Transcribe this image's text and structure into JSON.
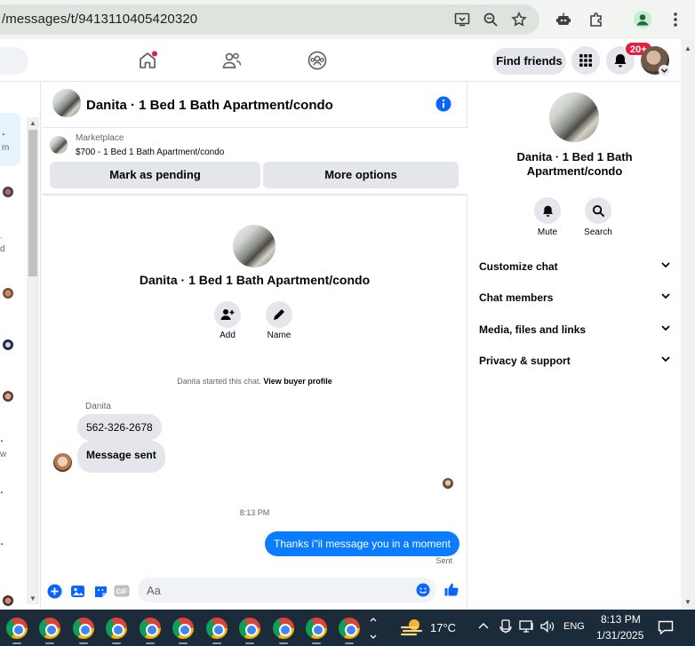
{
  "browser": {
    "url": "/messages/t/9413110405420320"
  },
  "header": {
    "find_friends_label": "Find friends",
    "notification_count": "20+"
  },
  "conversation": {
    "title": "Danita · 1 Bed 1 Bath Apartment/condo",
    "marketplace_label": "Marketplace",
    "listing": "$700 - 1 Bed 1 Bath Apartment/condo",
    "mark_pending_label": "Mark as pending",
    "more_options_label": "More options",
    "intro_title": "Danita · 1 Bed 1 Bath Apartment/condo",
    "add_label": "Add",
    "name_label": "Name",
    "system_message": "Danita started this chat.",
    "view_buyer_profile": "View buyer profile",
    "sender_name": "Danita",
    "messages_in": [
      "562-326-2678",
      "Message sent"
    ],
    "timestamp": "8:13 PM",
    "message_out": "Thanks i\"il message you in a moment",
    "sent_status": "Sent",
    "composer_placeholder": "Aa"
  },
  "right_panel": {
    "title": "Danita · 1 Bed 1 Bath Apartment/condo",
    "mute_label": "Mute",
    "search_label": "Search",
    "sections": [
      "Customize chat",
      "Chat members",
      "Media, files and links",
      "Privacy & support"
    ]
  },
  "left_list": {
    "fragments": [
      ".",
      "m",
      "d",
      "w"
    ]
  },
  "taskbar": {
    "temperature": "17°C",
    "language": "ENG",
    "time": "8:13 PM",
    "date": "1/31/2025"
  },
  "colors": {
    "messenger_blue": "#0a7cff",
    "badge_red": "#e41e3f",
    "info_blue": "#0866ff",
    "taskbar_bg": "#1c2b3a"
  },
  "icons": [
    "screen-cast-icon",
    "zoom-icon",
    "star-icon",
    "extension-robot-icon",
    "puzzle-icon",
    "profile-icon",
    "kebab-menu-icon",
    "home-icon",
    "friends-icon",
    "groups-icon",
    "menu-grid-icon",
    "bell-icon",
    "info-icon",
    "add-person-icon",
    "pencil-icon",
    "plus-circle-icon",
    "image-icon",
    "sticker-icon",
    "gif-icon",
    "emoji-icon",
    "thumbs-up-icon",
    "mute-bell-icon",
    "search-icon",
    "chevron-down-icon",
    "chrome-icon",
    "weather-icon",
    "notification-icon"
  ]
}
